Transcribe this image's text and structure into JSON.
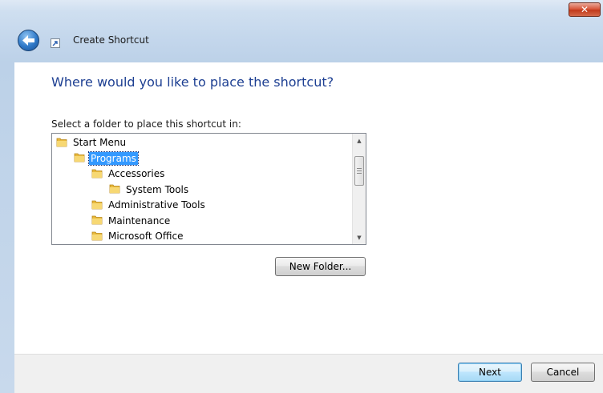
{
  "window": {
    "title": "Create Shortcut",
    "close_glyph": "✕"
  },
  "header": {
    "heading": "Where would you like to place the shortcut?"
  },
  "folder_picker": {
    "label": "Select a folder to place this shortcut in:",
    "tree": [
      {
        "label": "Start Menu",
        "level": 0,
        "selected": false
      },
      {
        "label": "Programs",
        "level": 1,
        "selected": true
      },
      {
        "label": "Accessories",
        "level": 2,
        "selected": false
      },
      {
        "label": "System Tools",
        "level": 3,
        "selected": false
      },
      {
        "label": "Administrative Tools",
        "level": 2,
        "selected": false
      },
      {
        "label": "Maintenance",
        "level": 2,
        "selected": false
      },
      {
        "label": "Microsoft Office",
        "level": 2,
        "selected": false
      }
    ]
  },
  "buttons": {
    "new_folder": "New Folder...",
    "next": "Next",
    "cancel": "Cancel"
  },
  "icons": {
    "back": "back-arrow-icon",
    "shortcut": "shortcut-icon",
    "folder": "folder-icon",
    "close": "close-icon"
  },
  "colors": {
    "heading": "#1d3f92",
    "selection": "#3399ff",
    "close_button": "#c13a1c",
    "folder": "#f2c94c"
  }
}
